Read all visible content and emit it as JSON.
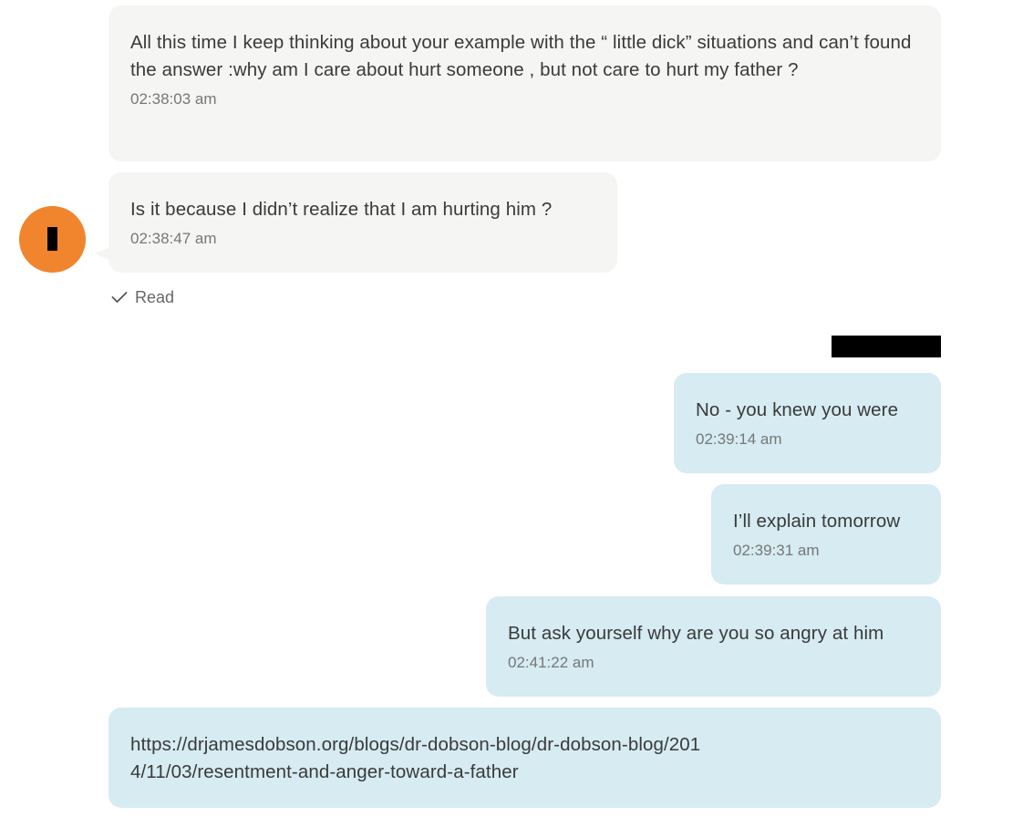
{
  "conversation": {
    "messages": [
      {
        "direction": "incoming",
        "text": "All this time I  keep thinking about your example with the “ little dick” situations and can’t found the answer :why am I care about hurt someone , but not care to hurt my father ?",
        "time": "02:38:03 am"
      },
      {
        "direction": "incoming",
        "text": "Is it because  I didn’t realize that I am hurting him ?",
        "time": "02:38:47 am"
      },
      {
        "direction": "outgoing",
        "text": "No - you knew you were",
        "time": "02:39:14 am"
      },
      {
        "direction": "outgoing",
        "text": "I’ll explain tomorrow",
        "time": "02:39:31 am"
      },
      {
        "direction": "outgoing",
        "text": "But ask yourself why are you so angry at him",
        "time": "02:41:22 am"
      },
      {
        "direction": "outgoing",
        "text": "https://drjamesdobson.org/blogs/dr-dobson-blog/dr-dobson-blog/2014/11/03/resentment-and-anger-toward-a-father",
        "time": ""
      }
    ],
    "read_receipt": {
      "icon": "checkmark-icon",
      "label": "Read"
    },
    "avatar": {
      "color": "#f0852d",
      "initial_redacted": true
    },
    "sender_name_redacted": true
  },
  "colors": {
    "incoming_bubble": "#f5f5f4",
    "outgoing_bubble": "#d6ebf2",
    "avatar": "#f0852d"
  }
}
